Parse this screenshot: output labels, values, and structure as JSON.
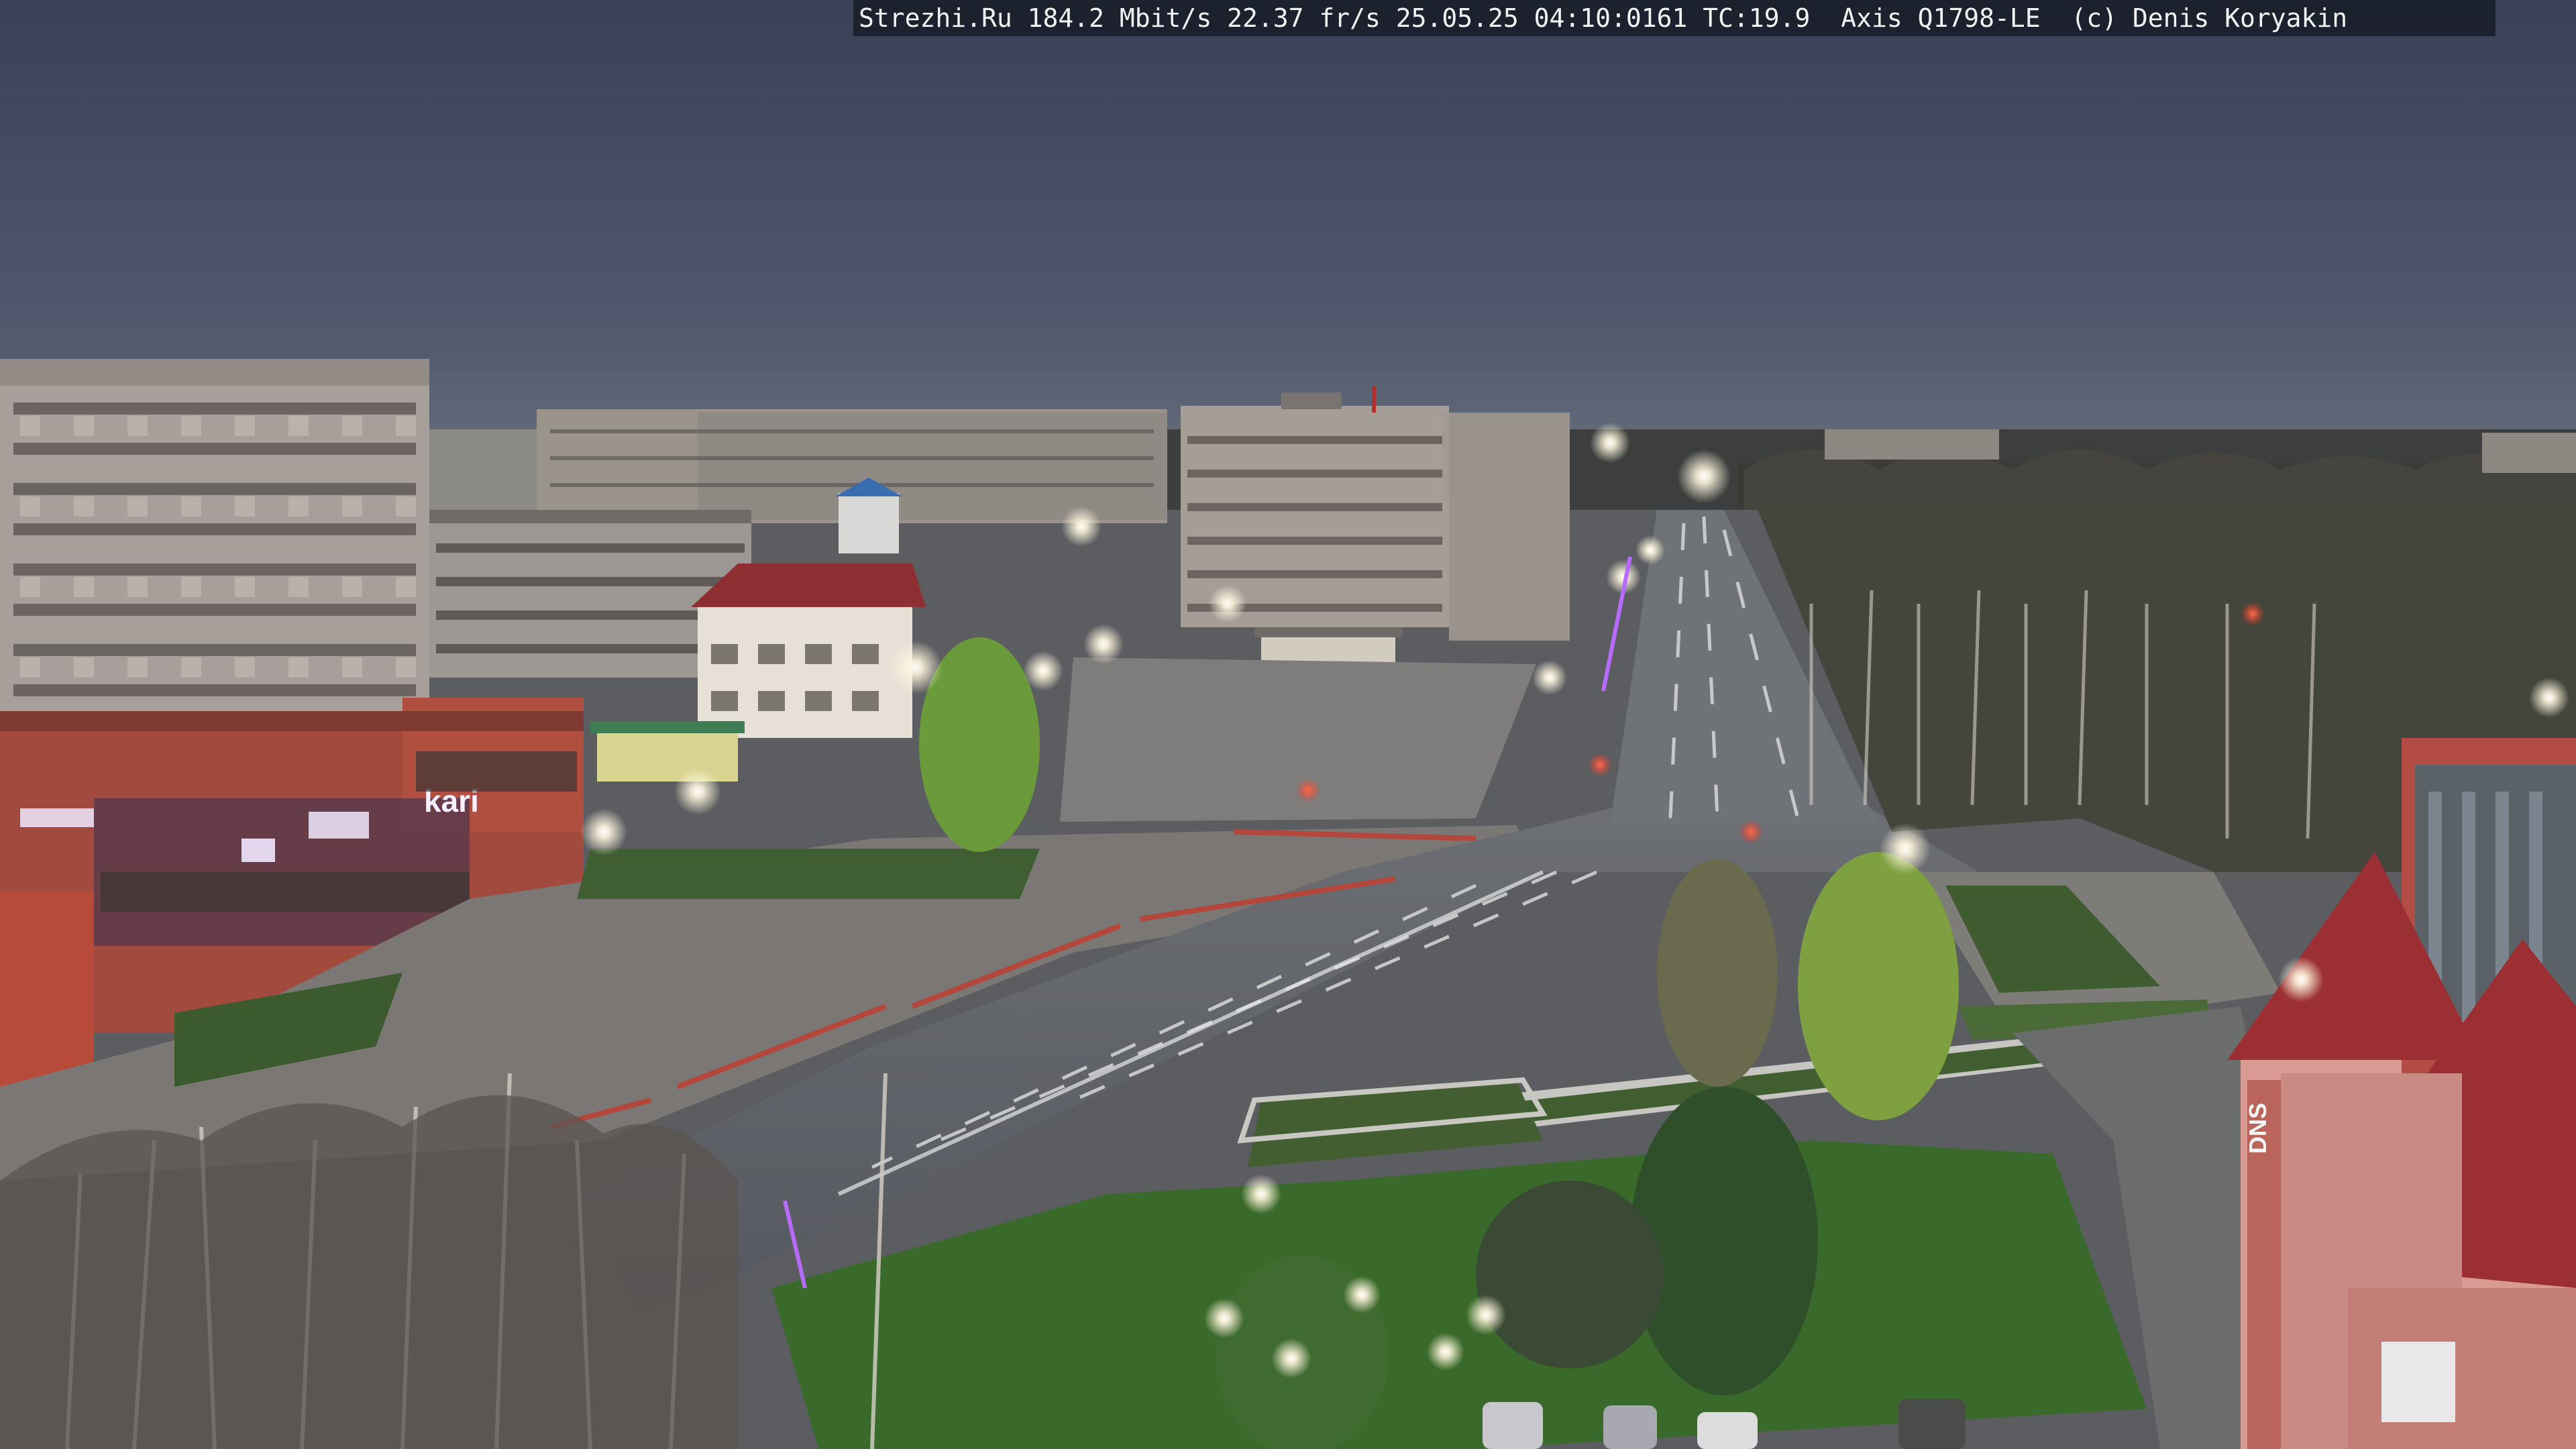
{
  "osd": {
    "text": "Strezhi.Ru 184.2 Mbit/s 22.37 fr/s 25.05.25 04:10:0161 TC:19.9  Axis Q1798-LE  (c) Denis Koryakin"
  },
  "signage": {
    "store_sign": "kari",
    "dns_sign": "DNS"
  },
  "palette": {
    "sky_top": "#3a4258",
    "sky_horizon": "#5f6878",
    "road": "#5a5d63",
    "grass": "#3e6b2e",
    "brick_red": "#a8453a",
    "roof_red": "#9c2f33",
    "lamp_glow": "#fff4d8"
  }
}
